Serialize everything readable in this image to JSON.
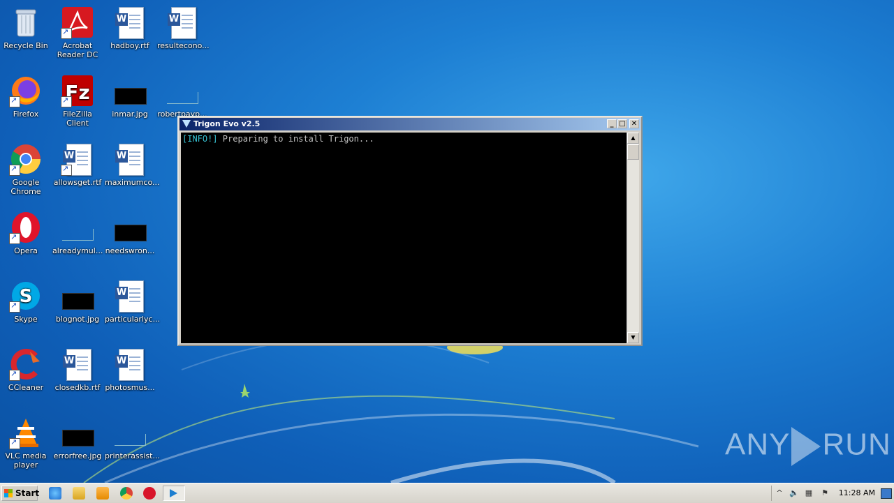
{
  "desktop": {
    "icons": [
      {
        "label": "Recycle Bin"
      },
      {
        "label": "Acrobat Reader DC"
      },
      {
        "label": "hadboy.rtf"
      },
      {
        "label": "resultecono..."
      },
      {
        "label": "Firefox"
      },
      {
        "label": "FileZilla Client"
      },
      {
        "label": "inmar.jpg"
      },
      {
        "label": "robertpayp..."
      },
      {
        "label": "Google Chrome"
      },
      {
        "label": "allowsget.rtf"
      },
      {
        "label": "maximumco..."
      },
      {
        "label": "Opera"
      },
      {
        "label": "alreadymul..."
      },
      {
        "label": "needswron..."
      },
      {
        "label": "Skype"
      },
      {
        "label": "blognot.jpg"
      },
      {
        "label": "particularlyc..."
      },
      {
        "label": "CCleaner"
      },
      {
        "label": "closedkb.rtf"
      },
      {
        "label": "photosmus..."
      },
      {
        "label": "VLC media player"
      },
      {
        "label": "errorfree.jpg"
      },
      {
        "label": "printerassist..."
      }
    ]
  },
  "window": {
    "title": "Trigon Evo v2.5",
    "console": {
      "tag": "[INFO!]",
      "message": " Preparing to install Trigon..."
    }
  },
  "taskbar": {
    "start_label": "Start",
    "clock": "11:28 AM"
  },
  "watermark": {
    "left": "ANY",
    "right": "RUN"
  },
  "colors": {
    "console_bg": "#000000",
    "info_tag": "#37c3d4",
    "title_active": "#0a246a"
  }
}
